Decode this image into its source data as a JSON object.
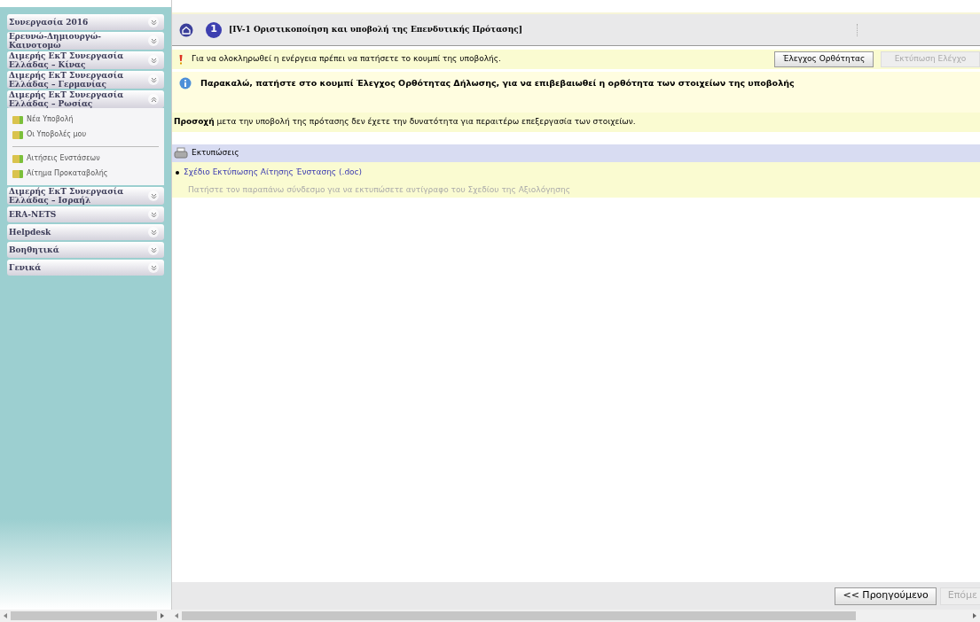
{
  "sidebar": {
    "sections": [
      {
        "title": "Συνεργασία 2016",
        "expanded": false
      },
      {
        "title": "Ερευνώ-Δημιουργώ-Καινοτομώ",
        "expanded": false
      },
      {
        "title": "Διμερής ΕκΤ Συνεργασία Ελλάδας – Κίνας",
        "expanded": false
      },
      {
        "title": "Διμερής ΕκΤ Συνεργασία Ελλάδας – Γερμανίας",
        "expanded": false
      },
      {
        "title": "Διμερής ΕκΤ Συνεργασία Ελλάδας – Ρωσίας",
        "expanded": true,
        "groups": [
          [
            "Νέα Υποβολή",
            "Οι Υποβολές μου"
          ],
          [
            "Αιτήσεις Ενστάσεων",
            "Αίτημα Προκαταβολής"
          ]
        ]
      },
      {
        "title": "Διμερής ΕκΤ Συνεργασία Ελλάδας – Ισραήλ",
        "expanded": false
      },
      {
        "title": "ERA-NETS",
        "expanded": false
      },
      {
        "title": "Helpdesk",
        "expanded": false
      },
      {
        "title": "Βοηθητικά",
        "expanded": false
      },
      {
        "title": "Γενικά",
        "expanded": false
      }
    ]
  },
  "header": {
    "step": "1",
    "title": "[IV-1 Οριστικοποίηση και υποβολή της Επενδυτικής Πρότασης]"
  },
  "notice": {
    "text": "Για να ολοκληρωθεί η ενέργεια πρέπει να πατήσετε το κουμπί της υποβολής.",
    "buttons": [
      {
        "label": "Έλεγχος Ορθότητας",
        "disabled": false
      },
      {
        "label": "Εκτύπωση Ελέγχο",
        "disabled": true
      }
    ]
  },
  "info": "Παρακαλώ, πατήστε στο κουμπί Έλεγχος Ορθότητας Δήλωσης, για να επιβεβαιωθεί η ορθότητα των στοιχείων της υποβολής",
  "warning": "**Προσοχή** μετα την υποβολή της πρότασης δεν έχετε την δυνατότητα για περαιτέρω επεξεργασία των στοιχείων.",
  "prints": {
    "title": "Εκτυπώσεις",
    "link": "Σχέδιο Εκτύπωσης Αίτησης Ένστασης (.doc)",
    "hint": "Πατήστε τον παραπάνω σύνδεσμο για να εκτυπώσετε αντίγραφο του Σχεδίου της Αξιολόγησης"
  },
  "footer": {
    "buttons": [
      {
        "label": "<< Προηγούμενο",
        "disabled": false
      },
      {
        "label": "Επόμε",
        "disabled": true
      }
    ]
  }
}
